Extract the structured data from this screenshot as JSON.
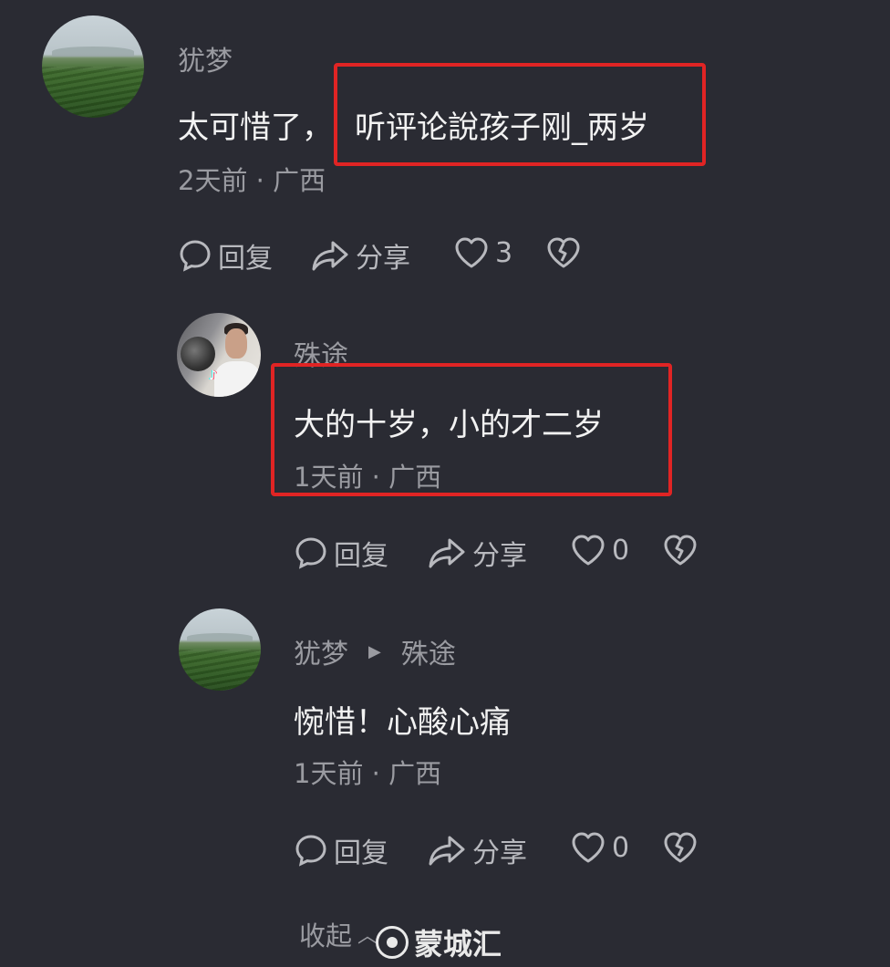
{
  "comments": [
    {
      "username": "犹梦",
      "text_before": "太可惜了，",
      "text_highlight": "听评论說孩子刚_两岁",
      "meta": "2天前 · 广西",
      "actions": {
        "reply": "回复",
        "share": "分享",
        "likes": "3"
      }
    },
    {
      "username": "殊途",
      "text": "大的十岁，小的才二岁",
      "meta": "1天前 · 广西",
      "actions": {
        "reply": "回复",
        "share": "分享",
        "likes": "0"
      }
    },
    {
      "username": "犹梦",
      "reply_to": "殊途",
      "text": "惋惜！心酸心痛",
      "meta": "1天前 · 广西",
      "actions": {
        "reply": "回复",
        "share": "分享",
        "likes": "0"
      }
    }
  ],
  "collapse_label": "收起",
  "watermark": "蒙城汇",
  "colors": {
    "background": "#2a2b33",
    "highlight_border": "#e02424",
    "secondary_text": "#9a9ba1"
  },
  "icons": [
    "comment-bubble-icon",
    "share-arrow-icon",
    "heart-icon",
    "broken-heart-icon",
    "chevron-up-icon",
    "play-triangle-icon",
    "logo-icon"
  ]
}
